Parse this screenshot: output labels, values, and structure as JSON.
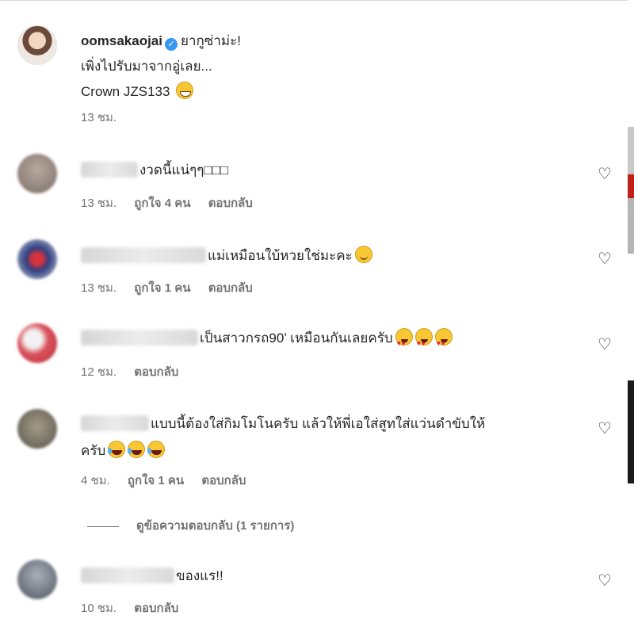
{
  "post": {
    "username": "oomsakaojai",
    "caption_line1": "ยากูซ่าม่ะ!",
    "caption_line2": "เพิ่งไปรับมาจากอู่เลย...",
    "caption_line3": "Crown JZS133",
    "time": "13 ชม.",
    "verified_icon": "verified-badge-icon",
    "emoji": "grinning-face"
  },
  "comments": [
    {
      "text": "งวดนี้แน่ๆๆ□□□",
      "time": "13 ชม.",
      "likes": "ถูกใจ 4 คน",
      "reply": "ตอบกลับ",
      "avatar_color": "#8a8079",
      "emojis": []
    },
    {
      "text": "แม่เหมือนใบ้หวยใช่มะคะ",
      "time": "13 ชม.",
      "likes": "ถูกใจ 1 คน",
      "reply": "ตอบกลับ",
      "avatar_color": "#3a4f8a",
      "emojis": [
        "smiling-face"
      ]
    },
    {
      "text": "เป็นสาวกรถ90’ เหมือนกันเลยครับ",
      "time": "12 ชม.",
      "likes": "",
      "reply": "ตอบกลับ",
      "avatar_color": "#c7646a",
      "emojis": [
        "heart-eyes",
        "heart-eyes",
        "heart-eyes"
      ]
    },
    {
      "text": "แบบนี้ต้องใส่กิมโมโนครับ แล้วให้พี่เอใส่สูทใส่แว่นดำขับให้",
      "text2": "ครับ",
      "time": "4 ชม.",
      "likes": "ถูกใจ 1 คน",
      "reply": "ตอบกลับ",
      "avatar_color": "#6d6a5a",
      "emojis": [
        "tears-of-joy",
        "tears-of-joy",
        "tears-of-joy"
      ]
    },
    {
      "text": "ของแร!!",
      "time": "10 ชม.",
      "likes": "",
      "reply": "ตอบกลับ",
      "avatar_color": "#5c6470",
      "emojis": []
    }
  ],
  "view_replies": "ดูข้อความตอบกลับ (1 รายการ)",
  "icons": {
    "like": "heart-outline-icon"
  }
}
